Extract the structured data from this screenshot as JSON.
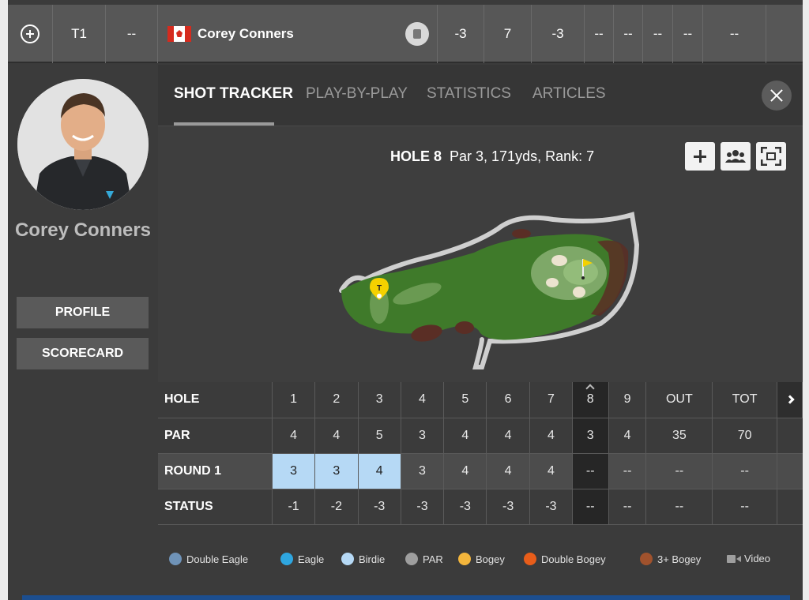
{
  "top_row": {
    "position": "T1",
    "prev": "--",
    "player_name": "Corey Conners",
    "to_par": "-3",
    "thru": "7",
    "today": "-3",
    "r1": "--",
    "r2": "--",
    "r3": "--",
    "r4": "--",
    "total": "--"
  },
  "player": {
    "name": "Corey Conners",
    "profile_label": "PROFILE",
    "scorecard_label": "SCORECARD"
  },
  "tabs": [
    "SHOT TRACKER",
    "PLAY-BY-PLAY",
    "STATISTICS",
    "ARTICLES"
  ],
  "hole": {
    "title": "HOLE 8",
    "details": "Par 3, 171yds, Rank: 7",
    "tee_marker": "T"
  },
  "scorecard": {
    "headers": [
      "HOLE",
      "1",
      "2",
      "3",
      "4",
      "5",
      "6",
      "7",
      "8",
      "9",
      "OUT",
      "TOT"
    ],
    "par": [
      "PAR",
      "4",
      "4",
      "5",
      "3",
      "4",
      "4",
      "4",
      "3",
      "4",
      "35",
      "70"
    ],
    "round1": [
      "ROUND 1",
      "3",
      "3",
      "4",
      "3",
      "4",
      "4",
      "4",
      "--",
      "--",
      "--",
      "--"
    ],
    "status": [
      "STATUS",
      "-1",
      "-2",
      "-3",
      "-3",
      "-3",
      "-3",
      "-3",
      "--",
      "--",
      "--",
      "--"
    ]
  },
  "legend": [
    {
      "label": "Double Eagle",
      "color": "#6f93b8"
    },
    {
      "label": "Eagle",
      "color": "#2ea6e0"
    },
    {
      "label": "Birdie",
      "color": "#b6d9f5"
    },
    {
      "label": "PAR",
      "color": "#9e9e9e"
    },
    {
      "label": "Bogey",
      "color": "#f4b63c"
    },
    {
      "label": "Double Bogey",
      "color": "#e85d1a"
    },
    {
      "label": "3+ Bogey",
      "color": "#a0522d"
    },
    {
      "label": "Video",
      "color": "#9e9e9e"
    }
  ]
}
